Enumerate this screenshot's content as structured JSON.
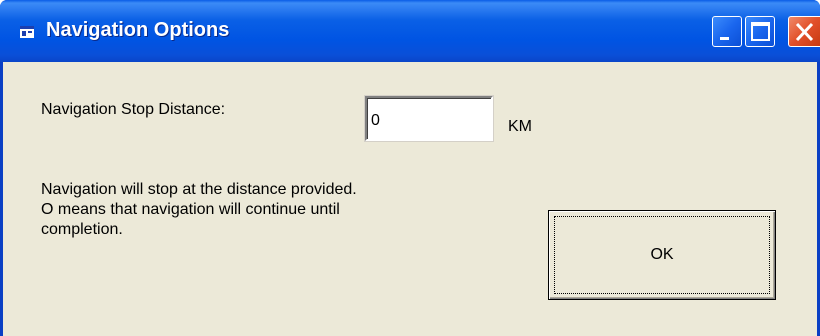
{
  "window": {
    "title": "Navigation Options",
    "controls": {
      "minimize_icon": "minimize-icon",
      "maximize_icon": "maximize-icon",
      "close_icon": "close-icon"
    }
  },
  "form": {
    "stop_distance_label": "Navigation Stop Distance:",
    "stop_distance_value": "0",
    "unit": "KM",
    "info_lines": [
      "Navigation will stop at the distance provided.",
      "O means that navigation will continue until",
      "completion."
    ],
    "ok_label": "OK"
  },
  "colors": {
    "titlebar": "#0054e3",
    "client_background": "#ece9d8",
    "close_button": "#e2502a"
  }
}
